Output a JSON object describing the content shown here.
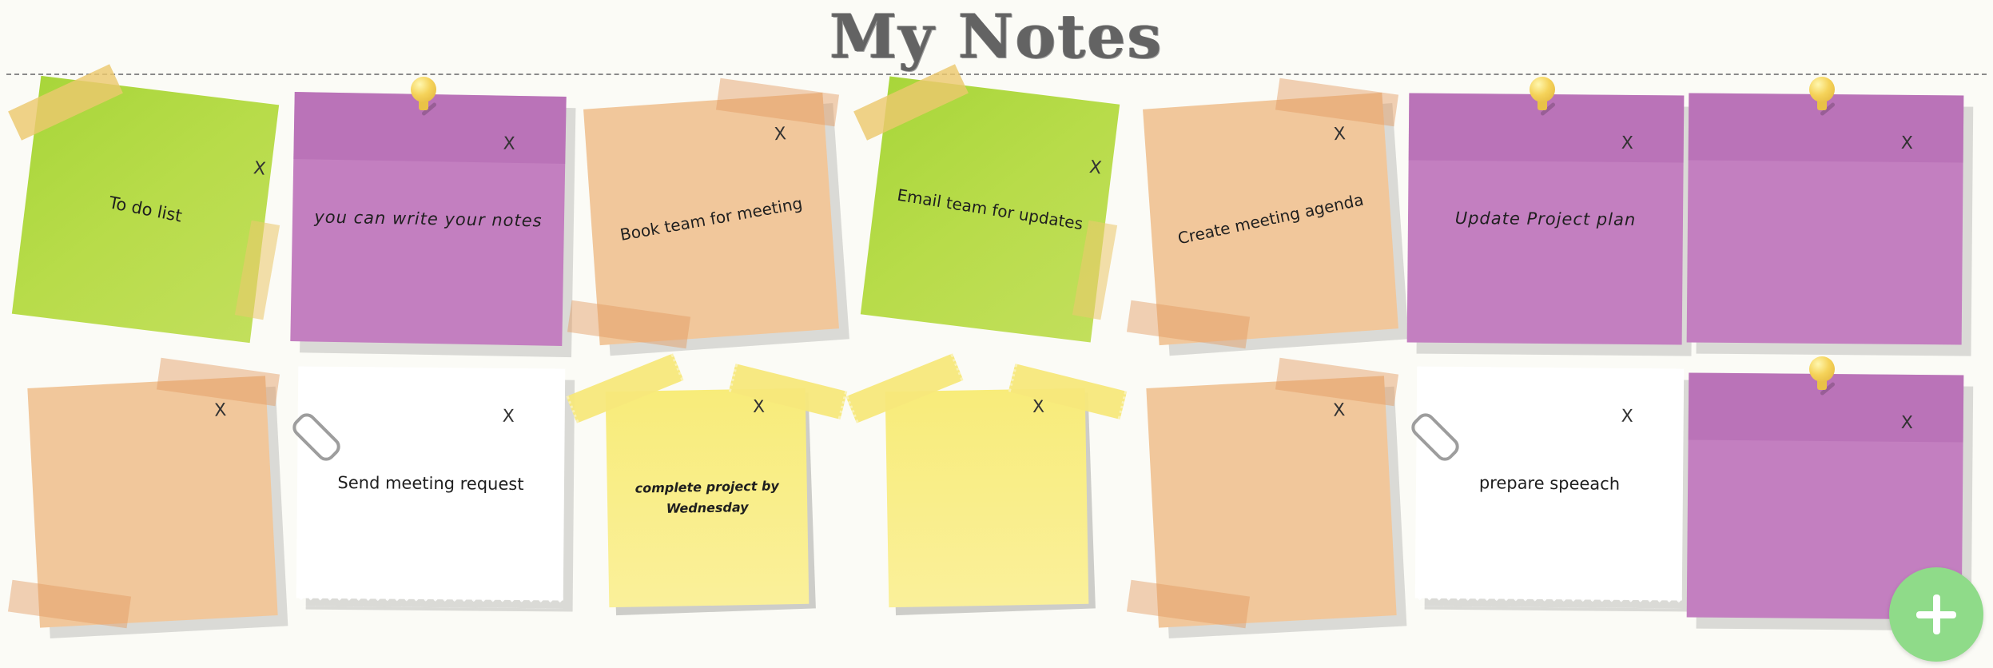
{
  "page": {
    "title": "My Notes"
  },
  "notes": [
    {
      "text": "To do list",
      "close": "X",
      "color": "green",
      "fastener": "tape"
    },
    {
      "text": "you can write your notes",
      "close": "X",
      "color": "purple",
      "fastener": "pin"
    },
    {
      "text": "Book team for meeting",
      "close": "X",
      "color": "peach",
      "fastener": "tape"
    },
    {
      "text": "Email team for updates",
      "close": "X",
      "color": "green",
      "fastener": "tape"
    },
    {
      "text": "Create meeting agenda",
      "close": "X",
      "color": "peach",
      "fastener": "tape"
    },
    {
      "text": "Update Project plan",
      "close": "X",
      "color": "purple",
      "fastener": "pin"
    },
    {
      "text": "",
      "close": "X",
      "color": "purple",
      "fastener": "pin"
    },
    {
      "text": "",
      "close": "X",
      "color": "peach",
      "fastener": "tape"
    },
    {
      "text": "Send meeting request",
      "close": "X",
      "color": "white",
      "fastener": "paperclip"
    },
    {
      "text": "complete project by Wednesday",
      "close": "X",
      "color": "yellow",
      "fastener": "tape"
    },
    {
      "text": "",
      "close": "X",
      "color": "yellow",
      "fastener": "tape"
    },
    {
      "text": "",
      "close": "X",
      "color": "peach",
      "fastener": "tape"
    },
    {
      "text": "prepare speeach",
      "close": "X",
      "color": "white",
      "fastener": "paperclip"
    },
    {
      "text": "",
      "close": "X",
      "color": "purple",
      "fastener": "pin"
    }
  ],
  "colors": {
    "green": "#b5d944",
    "purple": "#c37fc0",
    "peach": "#f1c79b",
    "white": "#ffffff",
    "yellow": "#f8ec7a",
    "fab": "#8fdb89"
  },
  "add_button": {
    "icon": "plus-icon"
  }
}
